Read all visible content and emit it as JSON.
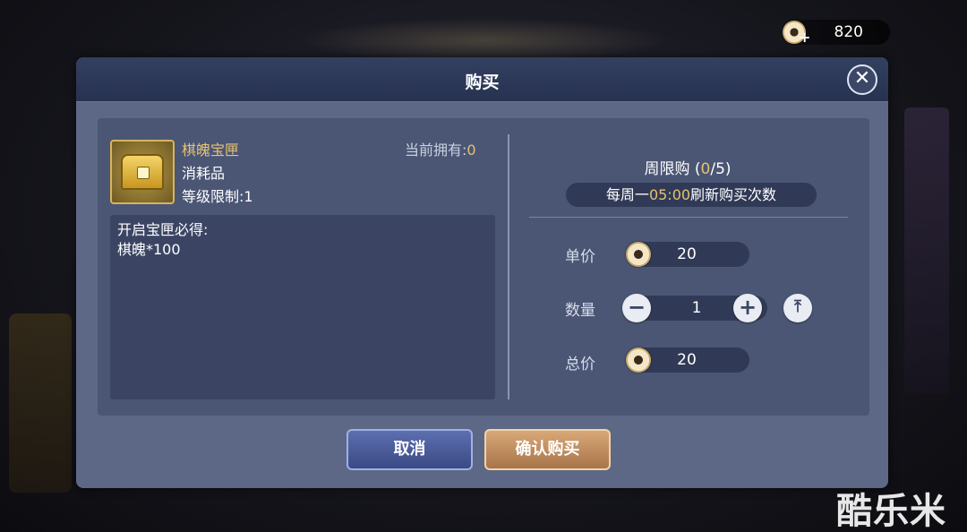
{
  "currency": {
    "amount": "820",
    "icon": "coin-icon",
    "add_icon": "plus-icon"
  },
  "dialog": {
    "title": "购买",
    "close_icon": "close-icon",
    "item": {
      "name": "棋魄宝匣",
      "type": "消耗品",
      "level_limit": "等级限制:1",
      "owned_label": "当前拥有:",
      "owned_value": "0",
      "icon": "treasure-chest-icon",
      "description_lines": [
        "开启宝匣必得:",
        "棋魄*100"
      ]
    },
    "purchase": {
      "weekly_label": "周限购 (",
      "weekly_count": "0",
      "weekly_sep": "/",
      "weekly_max": "5",
      "weekly_close": ")",
      "refresh_prefix": "每周一",
      "refresh_time": "05:00",
      "refresh_suffix": "刷新购买次数",
      "unit_price_label": "单价",
      "unit_price": "20",
      "quantity_label": "数量",
      "quantity": "1",
      "total_label": "总价",
      "total_price": "20"
    },
    "buttons": {
      "cancel": "取消",
      "confirm": "确认购买"
    }
  },
  "watermark": "酷乐米",
  "colors": {
    "accent_gold": "#e6c170",
    "panel": "#5d6886"
  }
}
